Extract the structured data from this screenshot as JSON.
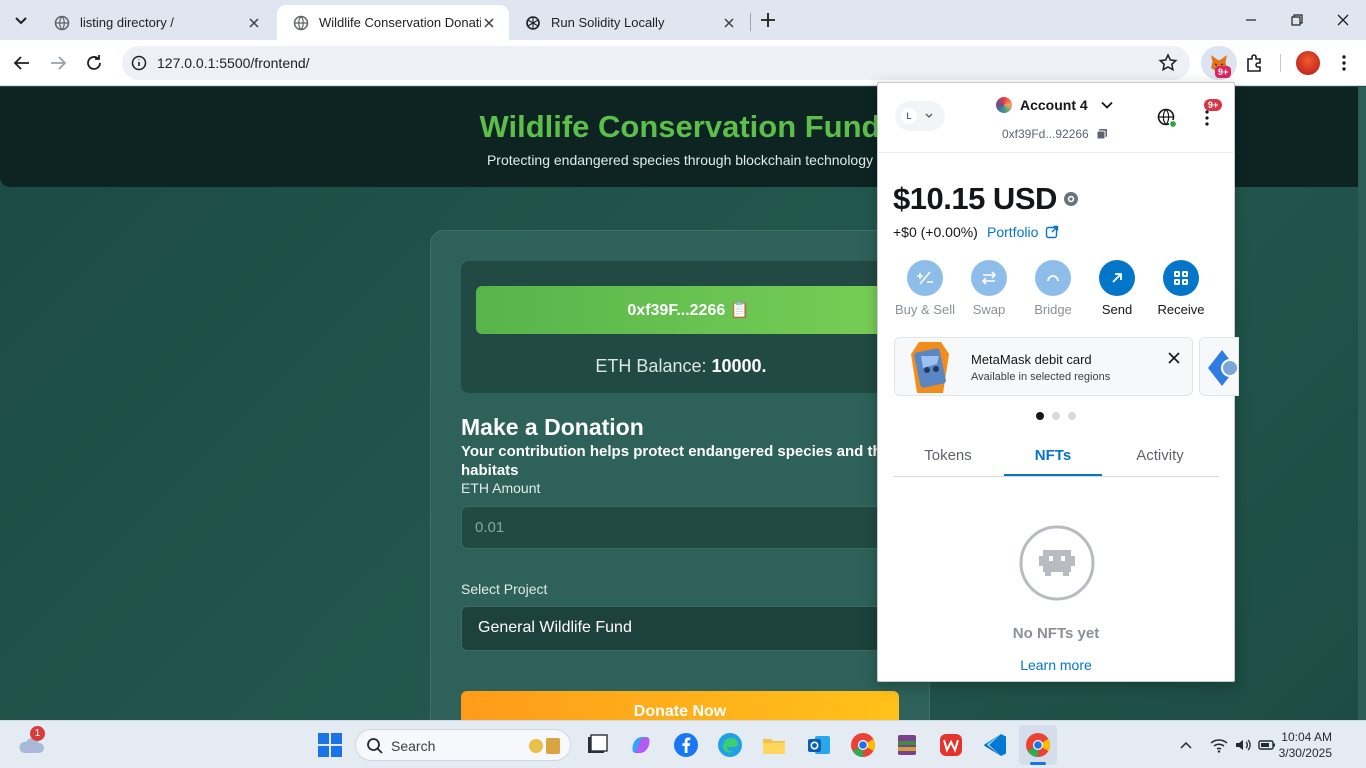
{
  "browser": {
    "tabs": [
      {
        "title": "listing directory /",
        "active": false
      },
      {
        "title": "Wildlife Conservation Donation",
        "active": true
      },
      {
        "title": "Run Solidity Locally",
        "active": false
      }
    ],
    "url": "127.0.0.1:5500/frontend/",
    "extension_badge": "9+"
  },
  "page": {
    "hero_title": "Wildlife Conservation Fund",
    "hero_subtitle": "Protecting endangered species through blockchain technology",
    "wallet_address": "0xf39F...2266 📋",
    "eth_balance_label": "ETH Balance:",
    "eth_balance_value": "10000.",
    "donation_title": "Make a Donation",
    "donation_description": "Your contribution helps protect endangered species and their habitats",
    "eth_amount_label": "ETH Amount",
    "eth_amount_placeholder": "0.01",
    "select_project_label": "Select Project",
    "selected_project": "General Wildlife Fund",
    "donate_button": "Donate Now"
  },
  "metamask": {
    "network_initial": "L",
    "account_name": "Account 4",
    "account_address": "0xf39Fd...92266",
    "notification_badge": "9+",
    "balance": "$10.15 USD",
    "change": "+$0 (+0.00%)",
    "portfolio_label": "Portfolio",
    "actions": [
      {
        "label": "Buy & Sell",
        "enabled": false
      },
      {
        "label": "Swap",
        "enabled": false
      },
      {
        "label": "Bridge",
        "enabled": false
      },
      {
        "label": "Send",
        "enabled": true
      },
      {
        "label": "Receive",
        "enabled": true
      }
    ],
    "promo_title": "MetaMask debit card",
    "promo_subtitle": "Available in selected regions",
    "tabs": [
      "Tokens",
      "NFTs",
      "Activity"
    ],
    "active_tab": "NFTs",
    "empty_title": "No NFTs yet",
    "learn_more": "Learn more",
    "accent_color": "#0376c9"
  },
  "taskbar": {
    "search_placeholder": "Search",
    "weather_badge": "1",
    "time": "10:04 AM",
    "date": "3/30/2025"
  }
}
